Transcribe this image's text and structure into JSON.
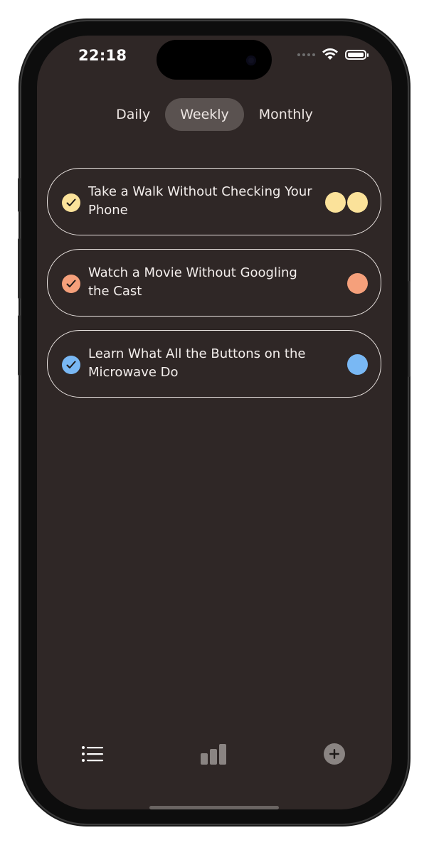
{
  "status_bar": {
    "time": "22:18"
  },
  "tabs": [
    {
      "label": "Daily",
      "active": false
    },
    {
      "label": "Weekly",
      "active": true
    },
    {
      "label": "Monthly",
      "active": false
    }
  ],
  "habits": [
    {
      "text": "Take a Walk Without Checking Your Phone",
      "color": "#fbe29a",
      "completions": 2,
      "checked": true
    },
    {
      "text": "Watch a Movie Without Googling the Cast",
      "color": "#f5a07b",
      "completions": 1,
      "checked": true
    },
    {
      "text": "Learn What All the Buttons on the Microwave Do",
      "color": "#79b8f4",
      "completions": 1,
      "checked": true
    }
  ],
  "bottom_nav": {
    "list_icon": "list-icon",
    "stats_icon": "bar-chart-icon",
    "add_icon": "add-circle-icon"
  },
  "colors": {
    "background": "#2f2726",
    "tab_active": "#5a5250",
    "text": "#f3eeec"
  }
}
